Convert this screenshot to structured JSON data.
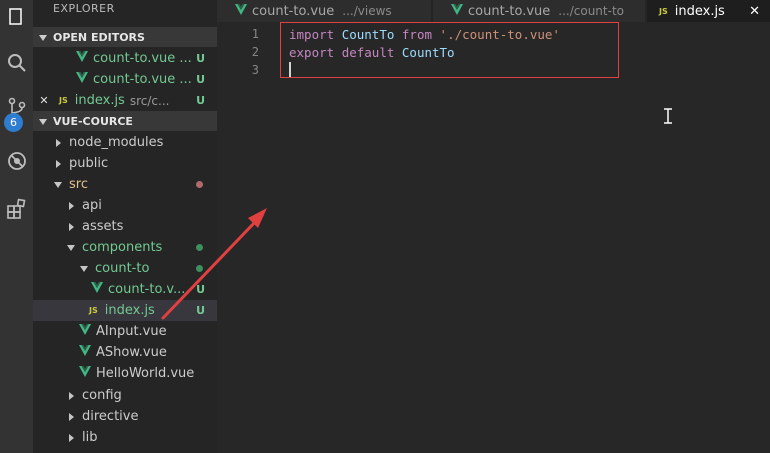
{
  "explorer": {
    "title": "EXPLORER",
    "open_editors": {
      "header": "OPEN EDITORS",
      "items": [
        {
          "name": "count-to.vue ...",
          "status": "U"
        },
        {
          "name": "count-to.vue ...",
          "status": "U"
        },
        {
          "name": "index.js",
          "path": "src/c...",
          "status": "U"
        }
      ]
    },
    "project": {
      "header": "VUE-COURCE",
      "tree": [
        {
          "label": "node_modules"
        },
        {
          "label": "public"
        },
        {
          "label": "src"
        },
        {
          "label": "api"
        },
        {
          "label": "assets"
        },
        {
          "label": "components"
        },
        {
          "label": "count-to"
        },
        {
          "label": "count-to.v...",
          "status": "U"
        },
        {
          "label": "index.js",
          "status": "U"
        },
        {
          "label": "AInput.vue"
        },
        {
          "label": "AShow.vue"
        },
        {
          "label": "HelloWorld.vue"
        },
        {
          "label": "config"
        },
        {
          "label": "directive"
        },
        {
          "label": "lib"
        }
      ]
    }
  },
  "activity_bar": {
    "source_control_badge": "6"
  },
  "tabs": [
    {
      "name": "count-to.vue",
      "path": ".../views"
    },
    {
      "name": "count-to.vue",
      "path": ".../count-to"
    },
    {
      "name": "index.js",
      "close": "✕"
    }
  ],
  "editor": {
    "lines": [
      {
        "number": "1",
        "t1": "import",
        "t2": "CountTo",
        "t3": "from",
        "t4": "'./count-to.vue'"
      },
      {
        "number": "2",
        "t1": "export",
        "t2": "default",
        "t3": "CountTo"
      },
      {
        "number": "3"
      }
    ]
  },
  "colors": {
    "modified_green": "#73c991",
    "annotation_red": "#e04040",
    "keyword": "#c586c0",
    "string": "#ce9178"
  }
}
